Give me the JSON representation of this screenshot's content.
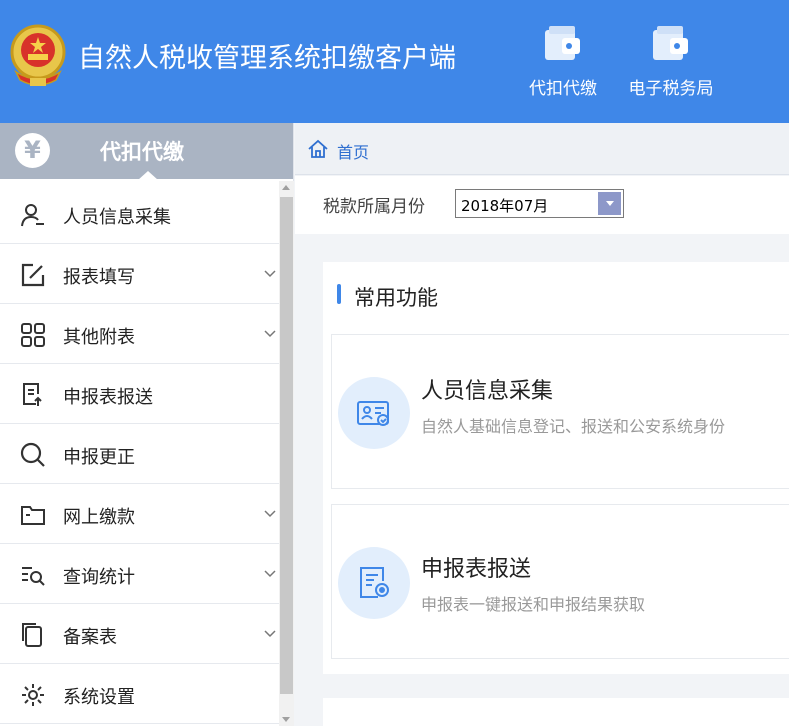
{
  "header": {
    "app_title": "自然人税收管理系统扣缴客户端",
    "buttons": [
      {
        "label": "代扣代缴",
        "icon": "wallet-icon"
      },
      {
        "label": "电子税务局",
        "icon": "wallet-icon"
      }
    ]
  },
  "sidebar": {
    "title": "代扣代缴",
    "title_icon": "yen-icon",
    "items": [
      {
        "label": "人员信息采集",
        "icon": "person-icon",
        "has_submenu": false
      },
      {
        "label": "报表填写",
        "icon": "edit-icon",
        "has_submenu": true
      },
      {
        "label": "其他附表",
        "icon": "grid-icon",
        "has_submenu": true
      },
      {
        "label": "申报表报送",
        "icon": "report-send-icon",
        "has_submenu": false
      },
      {
        "label": "申报更正",
        "icon": "search-icon",
        "has_submenu": false
      },
      {
        "label": "网上缴款",
        "icon": "folder-icon",
        "has_submenu": true
      },
      {
        "label": "查询统计",
        "icon": "list-search-icon",
        "has_submenu": true
      },
      {
        "label": "备案表",
        "icon": "copy-icon",
        "has_submenu": true
      },
      {
        "label": "系统设置",
        "icon": "gear-icon",
        "has_submenu": false
      }
    ]
  },
  "breadcrumb": {
    "home": "首页"
  },
  "filter": {
    "label": "税款所属月份",
    "month_value": "2018年07月"
  },
  "common_functions": {
    "title": "常用功能",
    "cards": [
      {
        "title": "人员信息采集",
        "desc": "自然人基础信息登记、报送和公安系统身份",
        "icon": "id-card-icon"
      },
      {
        "title": "申报表报送",
        "desc": "申报表一键报送和申报结果获取",
        "icon": "document-send-icon"
      }
    ]
  },
  "colors": {
    "header_bg": "#3f87e8",
    "sidebar_head_bg": "#aab4c3",
    "link_blue": "#2f6fd0",
    "card_icon_bg": "#e2eefc"
  }
}
